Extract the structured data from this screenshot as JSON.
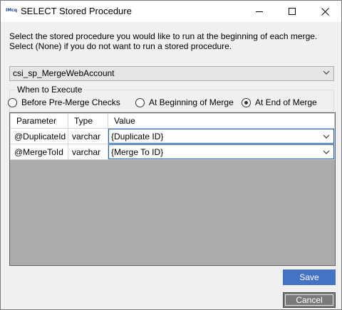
{
  "window": {
    "title": "SELECT Stored Procedure",
    "app_icon_text": "IMcq",
    "controls": [
      "minimize-icon",
      "maximize-icon",
      "close-icon"
    ]
  },
  "instructions": {
    "line1": "Select the stored procedure you would like to run at the beginning of each merge.",
    "line2": "Select (None) if you do not want to run a stored procedure."
  },
  "procedure_select": {
    "value": "csi_sp_MergeWebAccount"
  },
  "when_to_execute": {
    "legend": "When to Execute",
    "options": [
      {
        "label": "Before Pre-Merge Checks",
        "selected": false
      },
      {
        "label": "At Beginning of Merge",
        "selected": false
      },
      {
        "label": "At End of Merge",
        "selected": true
      }
    ]
  },
  "parameters_grid": {
    "columns": [
      "Parameter",
      "Type",
      "Value"
    ],
    "rows": [
      {
        "parameter": "@DuplicateId",
        "type": "varchar",
        "value": "{Duplicate ID}"
      },
      {
        "parameter": "@MergeToId",
        "type": "varchar",
        "value": "{Merge To ID}"
      }
    ]
  },
  "buttons": {
    "save": "Save",
    "cancel": "Cancel"
  },
  "colors": {
    "save_button": "#4472c4",
    "cancel_button": "#7a7a7a",
    "grid_empty_area": "#ababab",
    "value_selected_border": "#1b62b8"
  }
}
